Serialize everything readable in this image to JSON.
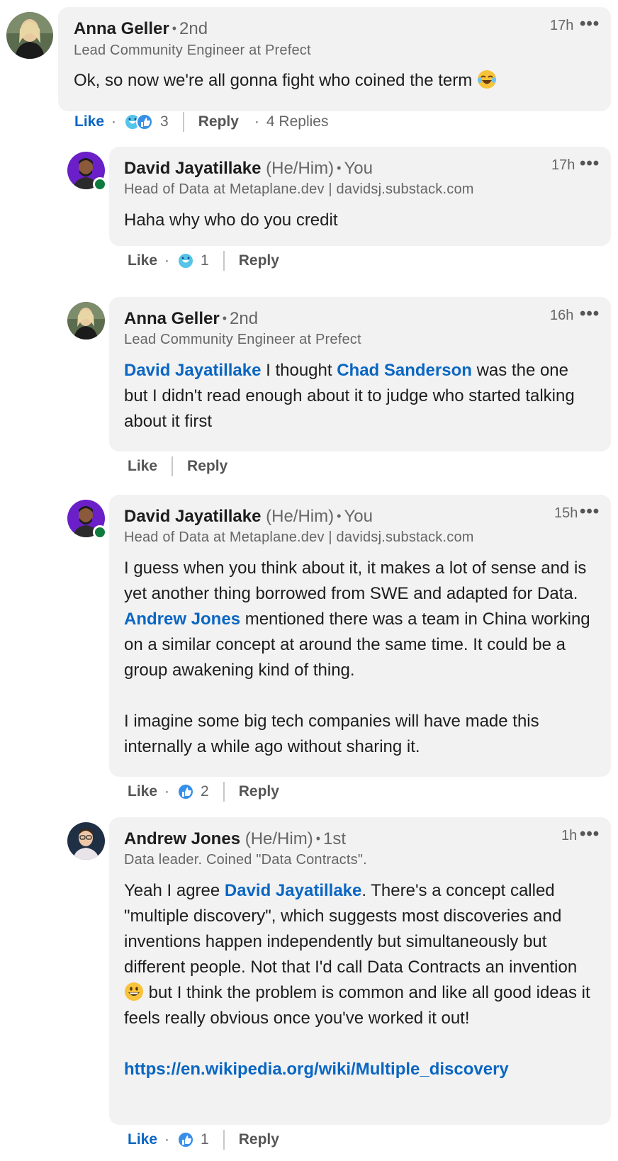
{
  "comments": [
    {
      "author": "Anna Geller",
      "pronouns": "",
      "degree": "2nd",
      "headline": "Lead Community Engineer at Prefect",
      "time": "17h",
      "more_icon": "•••",
      "text": "Ok, so now we're all gonna fight who coined the term",
      "emoji": "laughing-tears",
      "like_label": "Like",
      "reaction_count": "3",
      "reply_label": "Reply",
      "replies_label": "4 Replies"
    },
    {
      "author": "David Jayatillake",
      "pronouns": "(He/Him)",
      "degree": "You",
      "headline": "Head of Data at Metaplane.dev | davidsj.substack.com",
      "time": "17h",
      "more_icon": "•••",
      "text": "Haha why who do you credit",
      "like_label": "Like",
      "reaction_count": "1",
      "reply_label": "Reply"
    },
    {
      "author": "Anna Geller",
      "pronouns": "",
      "degree": "2nd",
      "headline": "Lead Community Engineer at Prefect",
      "time": "16h",
      "more_icon": "•••",
      "mention1": "David Jayatillake",
      "text_a": " I thought ",
      "mention2": "Chad Sanderson",
      "text_b": " was the one but I didn't read enough about it to judge who started talking about it first",
      "like_label": "Like",
      "reply_label": "Reply"
    },
    {
      "author": "David Jayatillake",
      "pronouns": "(He/Him)",
      "degree": "You",
      "headline": "Head of Data at Metaplane.dev | davidsj.substack.com",
      "time": "15h",
      "more_icon": "•••",
      "text_a": "I guess when you think about it, it makes a lot of sense and is yet another thing borrowed from SWE and adapted for Data. ",
      "mention": "Andrew Jones",
      "text_b": " mentioned there was a team in China working on a similar concept at around the same time. It could be a group awakening kind of thing.",
      "text_c": "I imagine some big tech companies will have made this internally a while ago without sharing it.",
      "like_label": "Like",
      "reaction_count": "2",
      "reply_label": "Reply"
    },
    {
      "author": "Andrew Jones",
      "pronouns": "(He/Him)",
      "degree": "1st",
      "headline": "Data leader. Coined \"Data Contracts\".",
      "time": "1h",
      "more_icon": "•••",
      "text_a": "Yeah I agree ",
      "mention": "David Jayatillake",
      "text_b": ". There's a concept called \"multiple discovery\", which suggests most discoveries and inventions happen independently but simultaneously but different people. Not that I'd call Data Contracts an invention ",
      "text_c": " but I think the problem is common and like all good ideas it feels really obvious once you've worked it out!",
      "emoji": "grinning-face",
      "link": "https://en.wikipedia.org/wiki/Multiple_discovery",
      "like_label": "Like",
      "reaction_count": "1",
      "reply_label": "Reply"
    }
  ],
  "colors": {
    "mention": "#0a66c2",
    "bubble": "#f2f2f2",
    "online": "#117a3e"
  }
}
